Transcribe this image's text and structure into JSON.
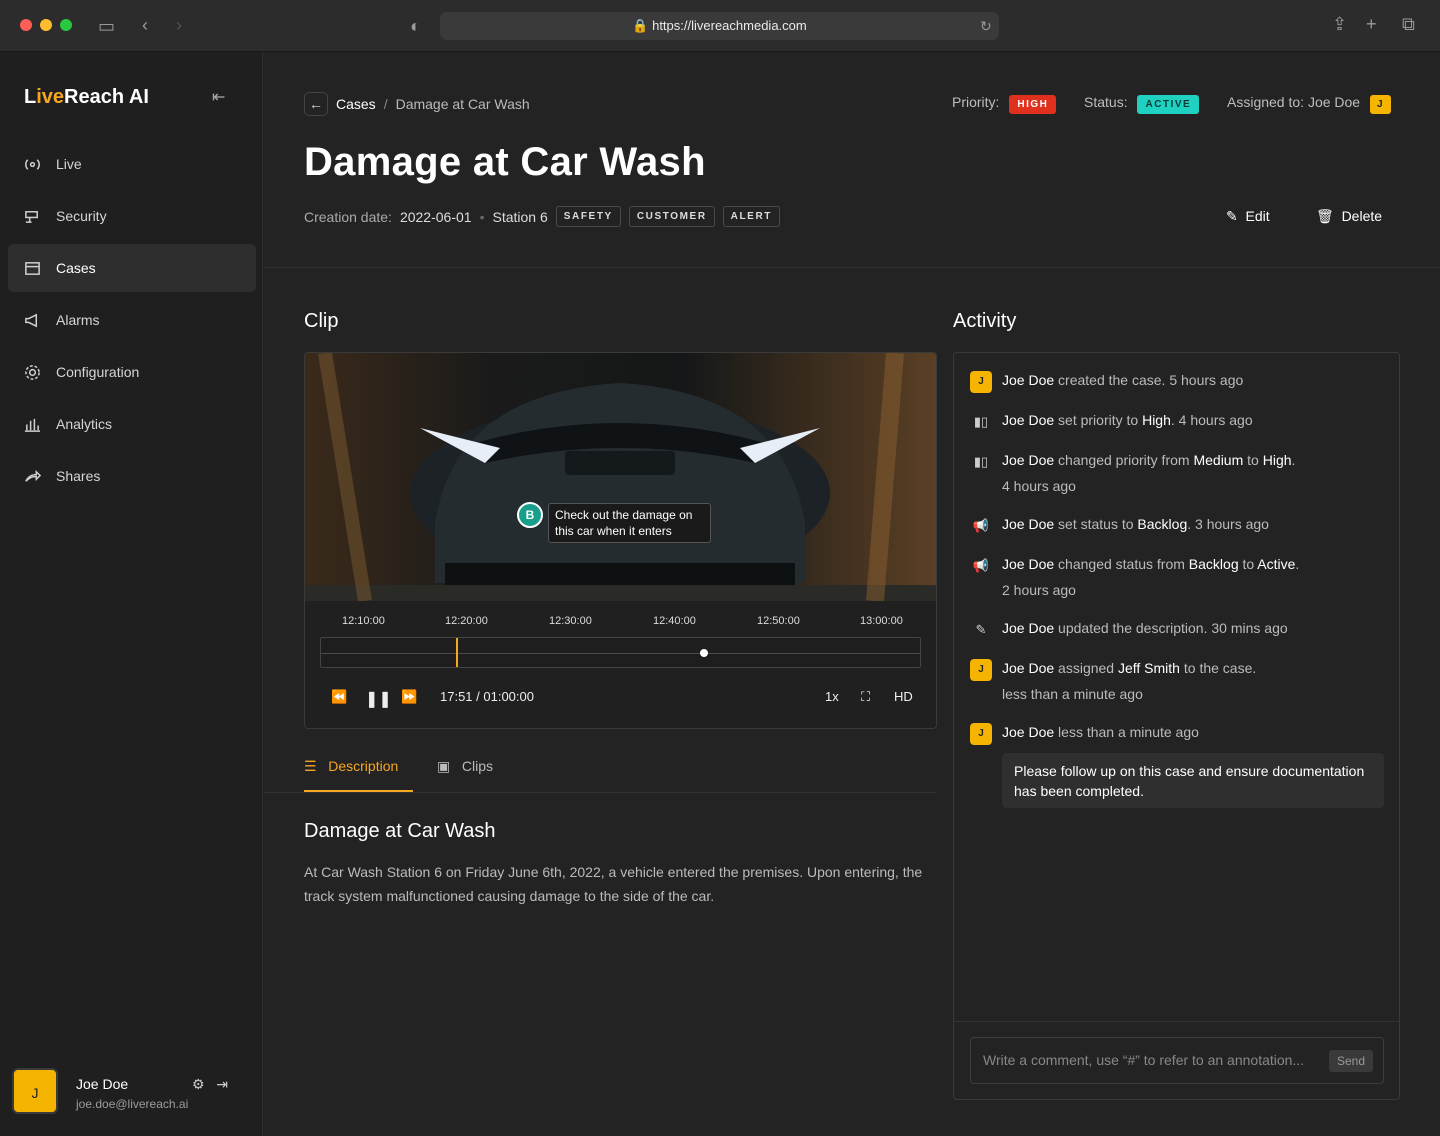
{
  "browser": {
    "url": "https://livereachmedia.com"
  },
  "app": {
    "brand_prefix": "L",
    "brand_accent": "ive",
    "brand_rest": "Reach AI"
  },
  "sidebar": {
    "items": [
      {
        "label": "Live",
        "icon": "live-icon"
      },
      {
        "label": "Security",
        "icon": "camera-icon"
      },
      {
        "label": "Cases",
        "icon": "folder-icon",
        "active": true
      },
      {
        "label": "Alarms",
        "icon": "megaphone-icon"
      },
      {
        "label": "Configuration",
        "icon": "gear-icon"
      },
      {
        "label": "Analytics",
        "icon": "bar-chart-icon"
      },
      {
        "label": "Shares",
        "icon": "share-icon"
      }
    ]
  },
  "user": {
    "initial": "J",
    "name": "Joe Doe",
    "email": "joe.doe@livereach.ai"
  },
  "header": {
    "crumb_root": "Cases",
    "crumb_sep": "/",
    "crumb_current": "Damage at Car Wash",
    "priority_label": "Priority:",
    "priority": "HIGH",
    "status_label": "Status:",
    "status": "ACTIVE",
    "assigned_label": "Assigned to: Joe Doe",
    "assigned_initial": "J"
  },
  "case": {
    "title": "Damage at Car Wash",
    "creation_label": "Creation date:",
    "creation_date": "2022-06-01",
    "station": "Station 6",
    "tags": [
      "SAFETY",
      "CUSTOMER",
      "ALERT"
    ],
    "edit_label": "Edit",
    "delete_label": "Delete"
  },
  "clip": {
    "heading": "Clip",
    "annotation_marker": "B",
    "annotation_text": "Check out the damage on this car when it enters",
    "ticks": [
      "12:10:00",
      "12:20:00",
      "12:30:00",
      "12:40:00",
      "12:50:00",
      "13:00:00"
    ],
    "time": "17:51 / 01:00:00",
    "speed": "1x",
    "quality": "HD",
    "progress": 0.225
  },
  "tabs": [
    {
      "label": "Description",
      "active": true
    },
    {
      "label": "Clips"
    }
  ],
  "description": {
    "title": "Damage at Car Wash",
    "body": "At Car Wash Station 6 on Friday June 6th, 2022, a vehicle entered the premises. Upon entering, the track system malfunctioned causing damage to the side of the car."
  },
  "activity": {
    "heading": "Activity",
    "items": [
      {
        "actor": "Joe Doe",
        "text": " created the case. 5 hours ago"
      },
      {
        "actor": "Joe Doe",
        "text": " set priority to ",
        "v1": "High",
        ".": ".",
        "time": " 4 hours ago"
      },
      {
        "actor": "Joe Doe",
        "text": " changed priority from ",
        "v1": "Medium",
        "mid": " to ",
        "v2": "High",
        "time": "4 hours ago"
      },
      {
        "actor": "Joe Doe",
        "text": " set status to ",
        "v1": "Backlog",
        "time": " 3 hours ago"
      },
      {
        "actor": "Joe Doe",
        "text": " changed status from ",
        "v1": "Backlog",
        "mid": " to ",
        "v2": "Active",
        "time": "2 hours ago"
      },
      {
        "actor": "Joe Doe",
        "text": " updated the description. 30 mins ago"
      },
      {
        "actor": "Joe Doe",
        "text": " assigned ",
        "v1": "Jeff Smith",
        "mid": " to the case.",
        "time": "less than a minute ago"
      },
      {
        "actor": "Joe Doe",
        "text": " less than a minute ago"
      }
    ],
    "note": "Please follow up on this case and ensure documentation has been completed.",
    "comment_placeholder": "Write a comment, use “#” to refer to an annotation...",
    "send": "Send"
  },
  "colors": {
    "accent": "#f5a623",
    "high": "#e0301e",
    "active": "#1fd1c1"
  }
}
